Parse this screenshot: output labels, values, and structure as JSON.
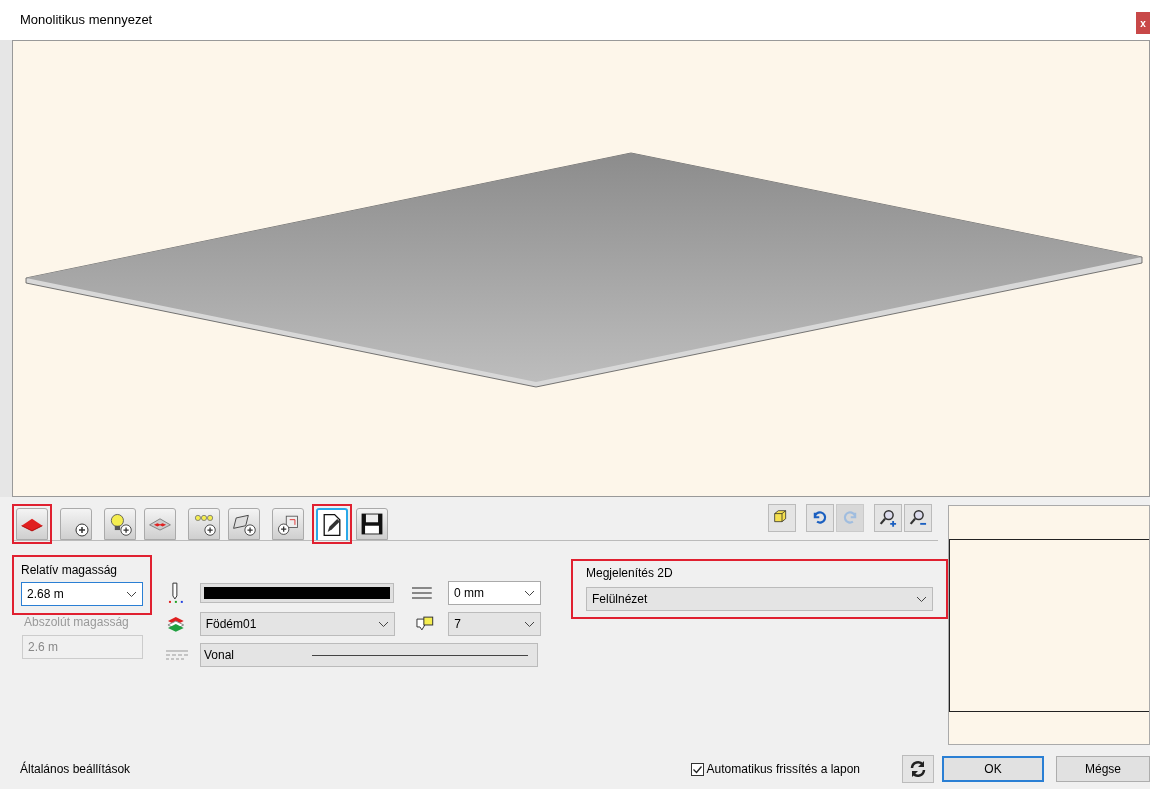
{
  "window": {
    "title": "Monolitikus mennyezet",
    "close": "x"
  },
  "tool_groups": [
    [
      {
        "selected": false,
        "highlighted": true
      }
    ],
    [
      {
        "selected": false,
        "highlighted": false
      }
    ],
    [
      {
        "selected": false,
        "highlighted": false
      },
      {
        "selected": false,
        "highlighted": false
      }
    ],
    [
      {
        "selected": false,
        "highlighted": false
      },
      {
        "selected": false,
        "highlighted": false
      }
    ],
    [
      {
        "selected": false,
        "highlighted": false
      }
    ],
    [
      {
        "selected": true,
        "highlighted": true
      },
      {
        "selected": false,
        "highlighted": false
      }
    ]
  ],
  "view_tools": [
    [
      {
        "disabled": false
      }
    ],
    [
      {
        "disabled": false
      },
      {
        "disabled": true
      }
    ],
    [
      {
        "disabled": false
      },
      {
        "disabled": false
      }
    ]
  ],
  "relative_height": {
    "label": "Relatív magasság",
    "value": "2.68 m",
    "highlighted": true
  },
  "absolute_height": {
    "label": "Abszolút magasság",
    "value": "2.6 m",
    "disabled": true
  },
  "pen": {
    "line_width": "0 mm"
  },
  "layer": {
    "value": "Födém01",
    "color_value": "7"
  },
  "line_type": {
    "value": "Vonal"
  },
  "display_2d": {
    "label": "Megjelenítés 2D",
    "value": "Felülnézet",
    "highlighted": true
  },
  "footer": {
    "section": "Általános beállítások",
    "auto_refresh": {
      "label": "Automatikus frissítés a lapon",
      "checked": true
    },
    "ok": "OK",
    "cancel": "Mégse"
  }
}
